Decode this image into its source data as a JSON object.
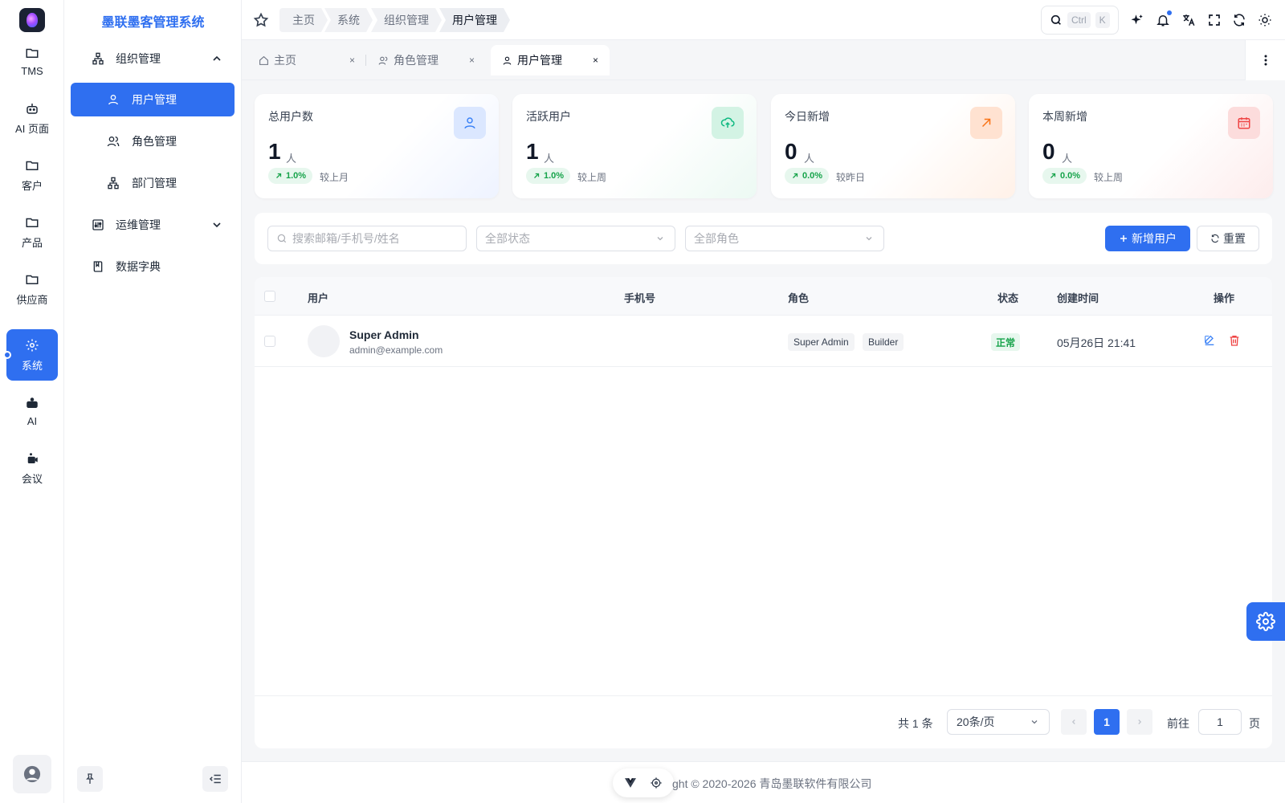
{
  "app": {
    "title": "墨联墨客管理系统"
  },
  "rail": {
    "items": [
      {
        "label": "TMS",
        "icon": "folder-icon"
      },
      {
        "label": "AI 页面",
        "icon": "robot-icon"
      },
      {
        "label": "客户",
        "icon": "folder-icon"
      },
      {
        "label": "产品",
        "icon": "folder-icon"
      },
      {
        "label": "供应商",
        "icon": "folder-icon"
      },
      {
        "label": "系统",
        "icon": "gear-icon",
        "active": true
      },
      {
        "label": "AI",
        "icon": "robot-filled-icon"
      },
      {
        "label": "会议",
        "icon": "meeting-icon"
      }
    ]
  },
  "menu": {
    "groups": [
      {
        "label": "组织管理",
        "icon": "org-chart-icon",
        "expanded": true
      },
      {
        "label": "运维管理",
        "icon": "ops-icon",
        "expanded": false
      },
      {
        "label": "数据字典",
        "icon": "book-icon"
      }
    ],
    "sub": [
      {
        "label": "用户管理",
        "icon": "user-icon",
        "active": true
      },
      {
        "label": "角色管理",
        "icon": "roles-icon"
      },
      {
        "label": "部门管理",
        "icon": "department-icon"
      }
    ]
  },
  "breadcrumb": [
    "主页",
    "系统",
    "组织管理",
    "用户管理"
  ],
  "search": {
    "kbd1": "Ctrl",
    "kbd2": "K"
  },
  "tabs": [
    {
      "label": "主页",
      "close": "×"
    },
    {
      "label": "角色管理",
      "close": "×"
    },
    {
      "label": "用户管理",
      "close": "×",
      "active": true
    }
  ],
  "stats": [
    {
      "title": "总用户数",
      "value": "1",
      "unit": "人",
      "change": "1.0%",
      "compare": "较上月",
      "icon": "user-icon",
      "accent": "#3b82f6"
    },
    {
      "title": "活跃用户",
      "value": "1",
      "unit": "人",
      "change": "1.0%",
      "compare": "较上周",
      "icon": "cloud-upload-icon",
      "accent": "#10b981"
    },
    {
      "title": "今日新增",
      "value": "0",
      "unit": "人",
      "change": "0.0%",
      "compare": "较昨日",
      "icon": "arrow-up-right-icon",
      "accent": "#f97316"
    },
    {
      "title": "本周新增",
      "value": "0",
      "unit": "人",
      "change": "0.0%",
      "compare": "较上周",
      "icon": "calendar-icon",
      "accent": "#ef4444"
    }
  ],
  "filters": {
    "search_placeholder": "搜索邮箱/手机号/姓名",
    "status_placeholder": "全部状态",
    "role_placeholder": "全部角色",
    "add_label": "新增用户",
    "reset_label": "重置"
  },
  "table": {
    "columns": [
      "用户",
      "手机号",
      "角色",
      "状态",
      "创建时间",
      "操作"
    ],
    "rows": [
      {
        "name": "Super Admin",
        "email": "admin@example.com",
        "phone": "",
        "roles": [
          "Super Admin",
          "Builder"
        ],
        "status": "正常",
        "created": "05月26日 21:41"
      }
    ]
  },
  "pagination": {
    "total": "共 1 条",
    "page_size": "20条/页",
    "current_page": "1",
    "goto_label": "前往",
    "goto_value": "1",
    "page_suffix": "页"
  },
  "footer": {
    "copyright": "ght © 2020-2026  青岛墨联软件有限公司"
  }
}
